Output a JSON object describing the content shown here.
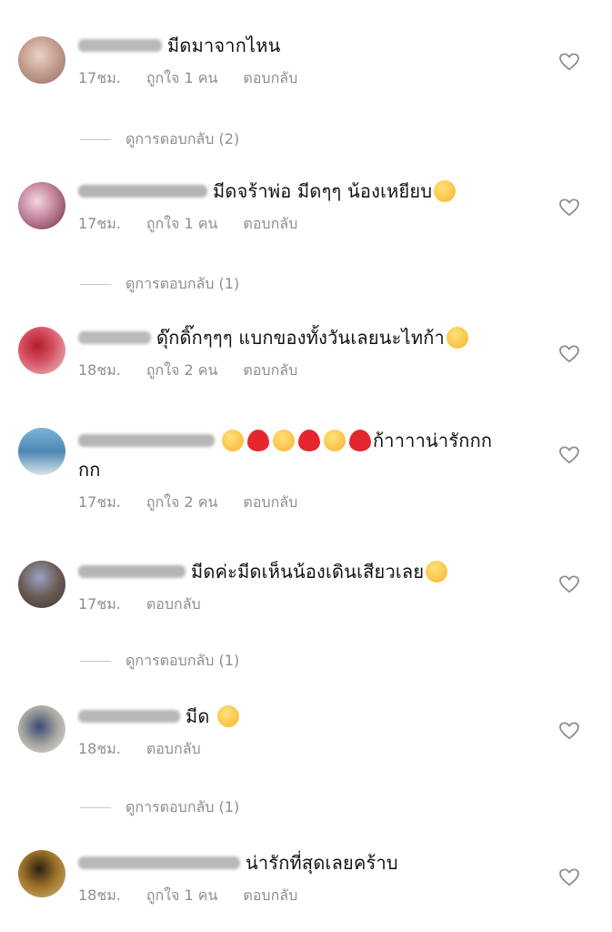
{
  "comments": [
    {
      "text": "มีดมาจากไหน",
      "time": "17ชม.",
      "likes": "ถูกใจ 1 คน",
      "reply": "ตอบกลับ",
      "view_replies": "ดูการตอบกลับ (2)"
    },
    {
      "text": "มีดจร้าพ่อ มีดๆๆ น้องเหยียบ",
      "time": "17ชม.",
      "likes": "ถูกใจ 1 คน",
      "reply": "ตอบกลับ",
      "view_replies": "ดูการตอบกลับ (1)"
    },
    {
      "text": "ดุ๊กดิ๊กๆๆๆ แบกของทั้งวันเลยนะไทก้า",
      "time": "18ชม.",
      "likes": "ถูกใจ 2 คน",
      "reply": "ตอบกลับ"
    },
    {
      "text_end": "ก้าาาาน่ารักกก",
      "text_line2": "กก",
      "time": "17ชม.",
      "likes": "ถูกใจ 2 คน",
      "reply": "ตอบกลับ"
    },
    {
      "text": "มีดค่ะมีดเห็นน้องเดินเสียวเลย",
      "time": "17ชม.",
      "reply": "ตอบกลับ",
      "view_replies": "ดูการตอบกลับ (1)"
    },
    {
      "text": "มีด",
      "time": "18ชม.",
      "reply": "ตอบกลับ",
      "view_replies": "ดูการตอบกลับ (1)"
    },
    {
      "text": "น่ารักที่สุดเลยคร้าบ",
      "time": "18ชม.",
      "likes": "ถูกใจ 1 คน",
      "reply": "ตอบกลับ"
    }
  ],
  "colors": {
    "meta_text": "#8e8e8e",
    "heart_stroke": "#8e8e8e"
  },
  "icons": [
    "heart-outline-icon",
    "smiling-sweat-emoji",
    "laughing-tears-emoji",
    "heart-eyes-emoji",
    "red-heart-emoji",
    "smiling-emoji",
    "frowning-emoji"
  ]
}
